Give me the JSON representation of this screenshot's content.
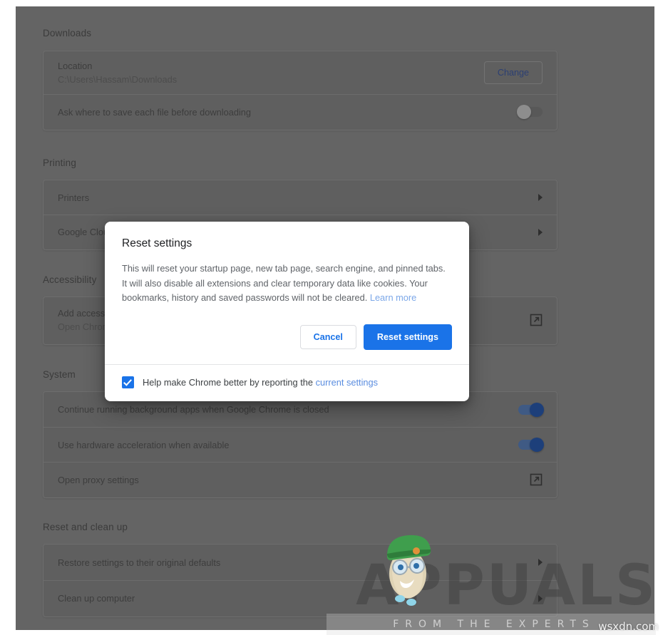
{
  "page": {
    "sections": [
      {
        "id": "downloads",
        "title": "Downloads",
        "rows": [
          {
            "label": "Location",
            "sub": "C:\\Users\\Hassam\\Downloads",
            "control": "button",
            "button_label": "Change"
          },
          {
            "label": "Ask where to save each file before downloading",
            "control": "toggle",
            "toggle_state": "off"
          }
        ]
      },
      {
        "id": "printing",
        "title": "Printing",
        "rows": [
          {
            "label": "Printers",
            "control": "chevron"
          },
          {
            "label": "Google Cloud Print",
            "control": "chevron"
          }
        ]
      },
      {
        "id": "accessibility",
        "title": "Accessibility",
        "rows": [
          {
            "label": "Add accessibility features",
            "sub": "Open Chrome Web Store",
            "control": "external-link"
          }
        ]
      },
      {
        "id": "system",
        "title": "System",
        "rows": [
          {
            "label": "Continue running background apps when Google Chrome is closed",
            "control": "toggle",
            "toggle_state": "on"
          },
          {
            "label": "Use hardware acceleration when available",
            "control": "toggle",
            "toggle_state": "on"
          },
          {
            "label": "Open proxy settings",
            "control": "external-link"
          }
        ]
      },
      {
        "id": "reset-and-clean-up",
        "title": "Reset and clean up",
        "rows": [
          {
            "label": "Restore settings to their original defaults",
            "control": "chevron"
          },
          {
            "label": "Clean up computer",
            "control": "chevron"
          }
        ]
      }
    ]
  },
  "dialog": {
    "title": "Reset settings",
    "body_text": "This will reset your startup page, new tab page, search engine, and pinned tabs. It will also disable all extensions and clear temporary data like cookies. Your bookmarks, history and saved passwords will not be cleared. ",
    "learn_more_label": "Learn more",
    "cancel_label": "Cancel",
    "confirm_label": "Reset settings",
    "footer_text": "Help make Chrome better by reporting the ",
    "footer_link_label": "current settings",
    "checkbox_checked": "true"
  },
  "watermark": {
    "word": "APPUALS",
    "tagline": "FROM THE EXPERTS",
    "site": "wsxdn.com"
  },
  "colors": {
    "primary_blue": "#1a73e8",
    "link_blue": "#5a8de0",
    "page_dim": "#646464",
    "card_dim": "#5f5f5f"
  }
}
